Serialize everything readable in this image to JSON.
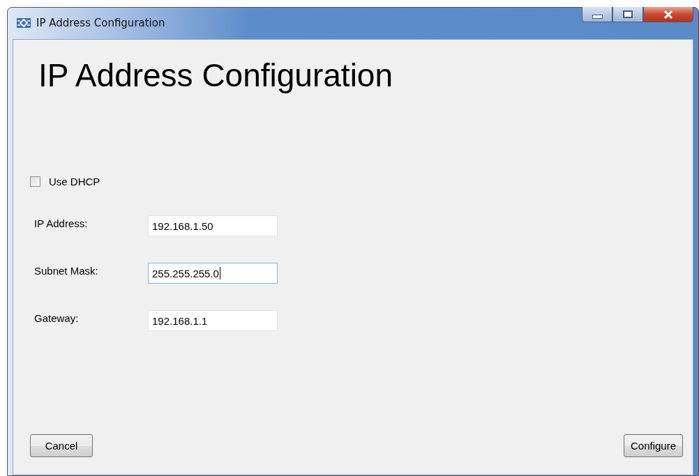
{
  "window": {
    "title": "IP Address Configuration"
  },
  "heading": "IP Address Configuration",
  "dhcp": {
    "label": "Use DHCP",
    "checked": false
  },
  "fields": [
    {
      "label": "IP Address:",
      "value": "192.168.1.50",
      "focused": false
    },
    {
      "label": "Subnet Mask:",
      "value": "255.255.255.0",
      "focused": true
    },
    {
      "label": "Gateway:",
      "value": "192.168.1.1",
      "focused": false
    }
  ],
  "buttons": [
    {
      "label": "Cancel"
    },
    {
      "label": "Configure"
    }
  ]
}
